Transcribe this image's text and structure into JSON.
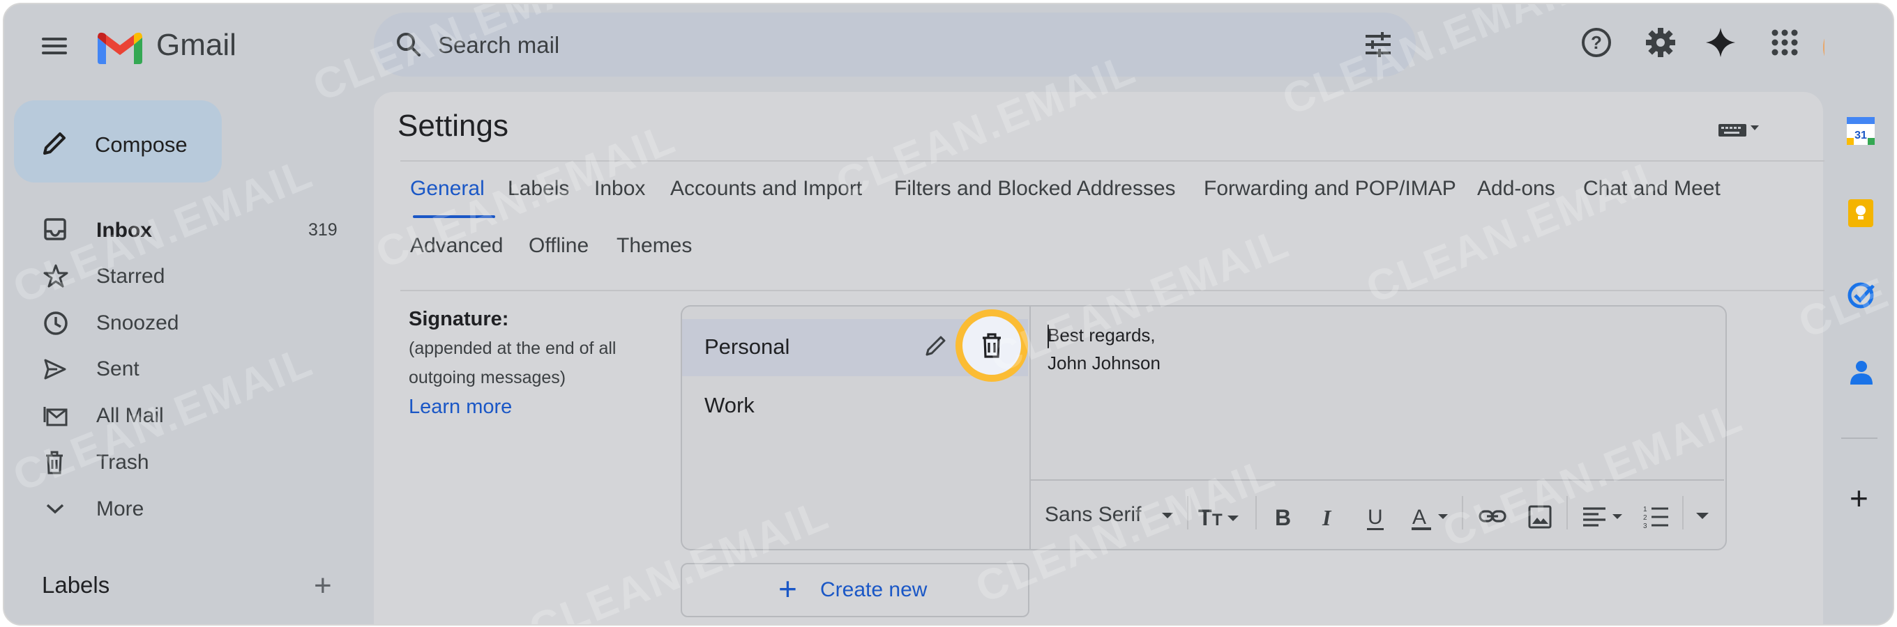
{
  "header": {
    "app_name": "Gmail",
    "search_placeholder": "Search mail",
    "icons": [
      "menu-icon",
      "search-icon",
      "tune-icon",
      "help-icon",
      "gear-icon",
      "gemini-icon",
      "apps-icon",
      "avatar"
    ]
  },
  "compose": {
    "label": "Compose"
  },
  "nav": [
    {
      "label": "Inbox",
      "count": "319",
      "icon": "inbox-icon",
      "bold": true
    },
    {
      "label": "Starred",
      "icon": "star-icon"
    },
    {
      "label": "Snoozed",
      "icon": "clock-icon"
    },
    {
      "label": "Sent",
      "icon": "send-icon"
    },
    {
      "label": "All Mail",
      "icon": "all-mail-icon"
    },
    {
      "label": "Trash",
      "icon": "trash-icon"
    },
    {
      "label": "More",
      "icon": "chevron-down-icon"
    }
  ],
  "labels_section": {
    "title": "Labels"
  },
  "settings": {
    "title": "Settings",
    "tabs_row1": [
      "General",
      "Labels",
      "Inbox",
      "Accounts and Import",
      "Filters and Blocked Addresses",
      "Forwarding and POP/IMAP",
      "Add-ons",
      "Chat and Meet"
    ],
    "tabs_row2": [
      "Advanced",
      "Offline",
      "Themes"
    ],
    "active_tab": "General",
    "signature": {
      "heading": "Signature:",
      "desc_line1": "(appended at the end of all",
      "desc_line2": "outgoing messages)",
      "learn_more": "Learn more",
      "list": [
        "Personal",
        "Work"
      ],
      "selected": "Personal",
      "body_line1": "Best regards,",
      "body_line2": "John Johnson",
      "font": "Sans Serif",
      "create_new": "Create new"
    }
  },
  "watermark": "CLEAN.EMAIL",
  "colors": {
    "accent": "#1a57c6",
    "highlight_ring": "#fbbc34",
    "compose_bg": "#b8cadb"
  }
}
